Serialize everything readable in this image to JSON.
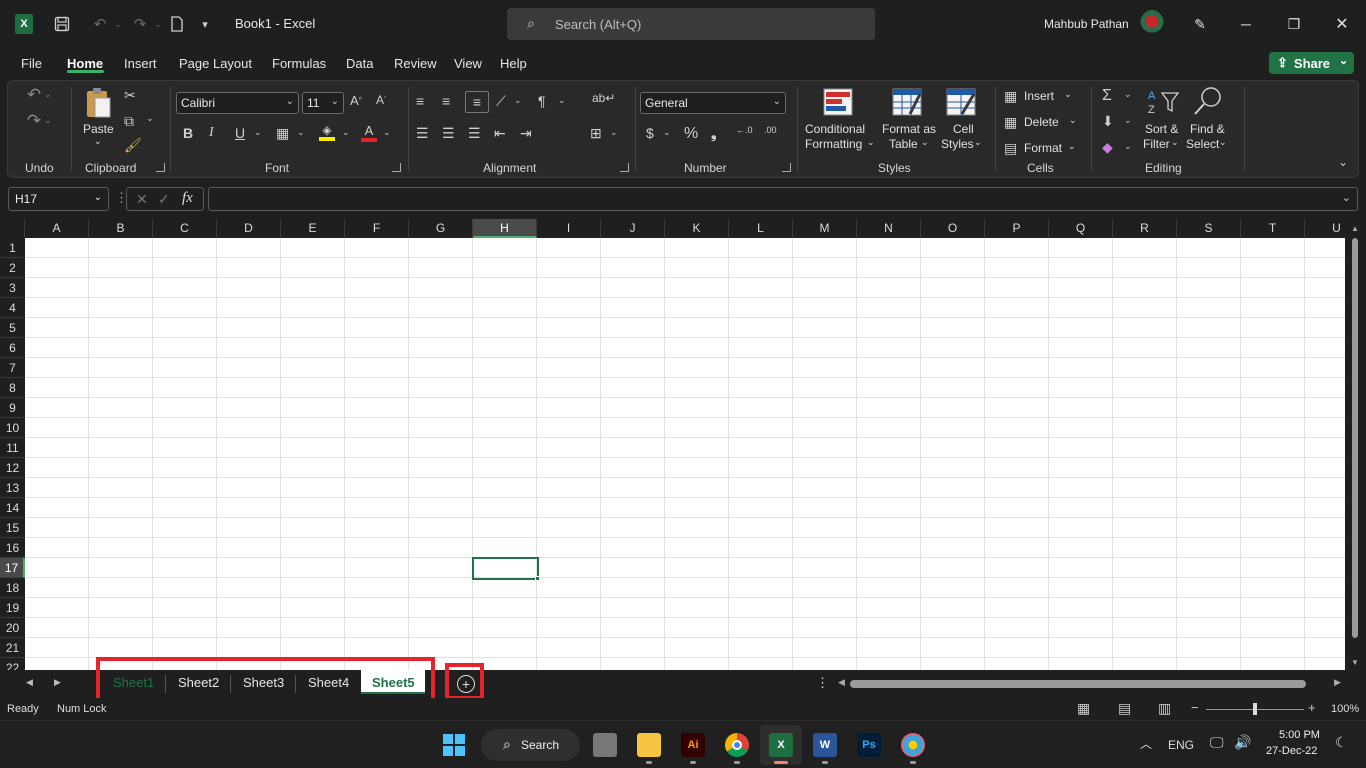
{
  "window": {
    "title": "Book1  -  Excel",
    "app_icon": "excel-icon",
    "search_placeholder": "Search (Alt+Q)",
    "user_name": "Mahbub Pathan"
  },
  "menu": {
    "tabs": [
      "File",
      "Home",
      "Insert",
      "Page Layout",
      "Formulas",
      "Data",
      "Review",
      "View",
      "Help"
    ],
    "active_tab": "Home",
    "share_label": "Share"
  },
  "ribbon": {
    "undo_group": "Undo",
    "clipboard": {
      "group": "Clipboard",
      "paste": "Paste"
    },
    "font": {
      "group": "Font",
      "family": "Calibri",
      "size": "11",
      "bold": "B",
      "italic": "I",
      "underline": "U"
    },
    "alignment": {
      "group": "Alignment"
    },
    "number": {
      "group": "Number",
      "format": "General"
    },
    "styles": {
      "group": "Styles",
      "conditional_1": "Conditional",
      "conditional_2": "Formatting",
      "format_table_1": "Format as",
      "format_table_2": "Table",
      "cell_styles_1": "Cell",
      "cell_styles_2": "Styles"
    },
    "cells": {
      "group": "Cells",
      "insert": "Insert",
      "delete": "Delete",
      "format": "Format"
    },
    "editing": {
      "group": "Editing",
      "sort_1": "Sort &",
      "sort_2": "Filter",
      "find_1": "Find &",
      "find_2": "Select"
    }
  },
  "formula_bar": {
    "name_box": "H17",
    "fx": "fx",
    "value": ""
  },
  "grid": {
    "columns": [
      "A",
      "B",
      "C",
      "D",
      "E",
      "F",
      "G",
      "H",
      "I",
      "J",
      "K",
      "L",
      "M",
      "N",
      "O",
      "P",
      "Q",
      "R",
      "S",
      "T",
      "U"
    ],
    "rows": [
      "1",
      "2",
      "3",
      "4",
      "5",
      "6",
      "7",
      "8",
      "9",
      "10",
      "11",
      "12",
      "13",
      "14",
      "15",
      "16",
      "17",
      "18",
      "19",
      "20",
      "21",
      "22"
    ],
    "active_column": "H",
    "active_row": "17"
  },
  "sheets": {
    "tabs": [
      "Sheet1",
      "Sheet2",
      "Sheet3",
      "Sheet4",
      "Sheet5"
    ],
    "active": "Sheet5"
  },
  "status": {
    "ready": "Ready",
    "num_lock": "Num Lock",
    "zoom": "100%"
  },
  "taskbar": {
    "search_label": "Search",
    "lang": "ENG",
    "time": "5:00 PM",
    "date": "27-Dec-22"
  },
  "highlight_color": "#e3242b",
  "accent_color": "#217346"
}
